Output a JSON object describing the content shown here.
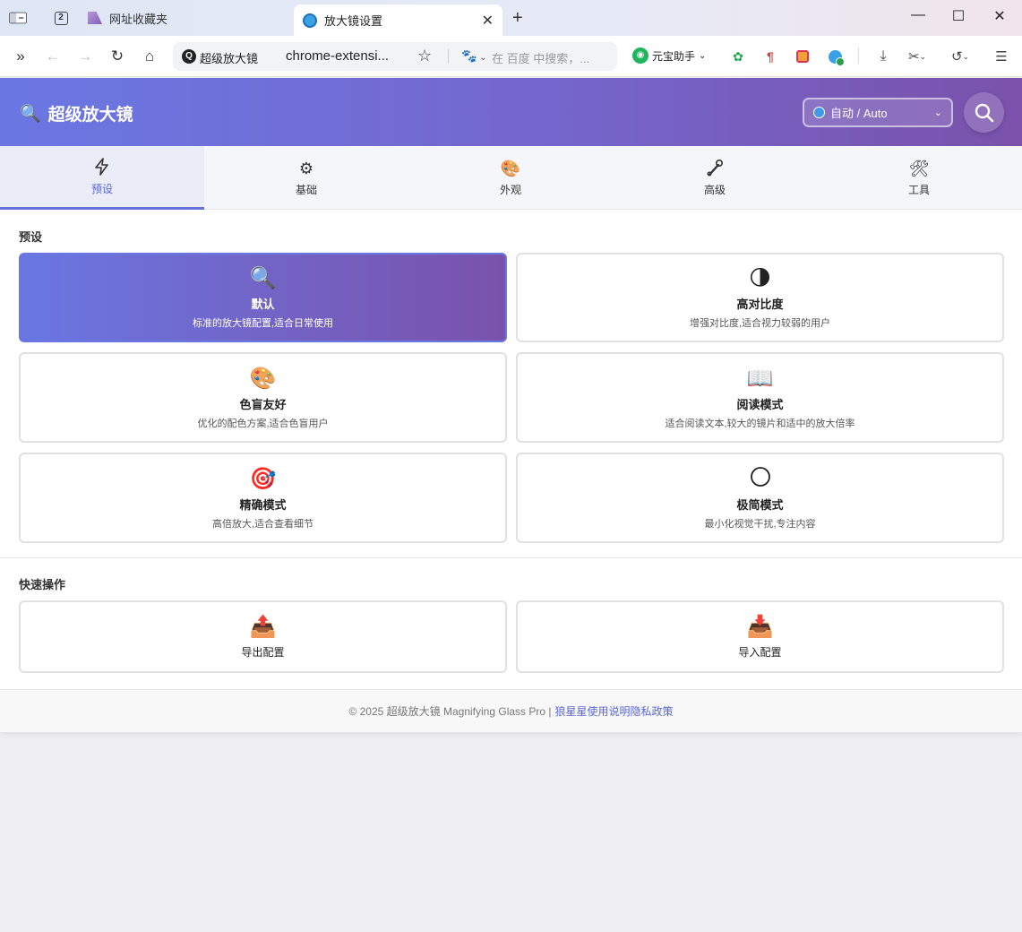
{
  "browser": {
    "tab_count": "2",
    "bookmarks_tab_label": "网址收藏夹",
    "active_tab_title": "放大镜设置",
    "omnibox_site": "超级放大镜",
    "omnibox_url": "chrome-extensi...",
    "search_placeholder": "在 百度 中搜索，...",
    "yuanbao_label": "元宝助手"
  },
  "app": {
    "title": "超级放大镜",
    "language_selected": "自动 / Auto"
  },
  "tabs": [
    {
      "label": "预设",
      "icon": "lightning-icon"
    },
    {
      "label": "基础",
      "icon": "gear-icon"
    },
    {
      "label": "外观",
      "icon": "palette-icon"
    },
    {
      "label": "高级",
      "icon": "wrench-icon"
    },
    {
      "label": "工具",
      "icon": "tools-icon"
    }
  ],
  "presets": {
    "section_title": "预设",
    "items": [
      {
        "name": "默认",
        "desc": "标准的放大镜配置,适合日常使用",
        "icon": "magnifier-icon"
      },
      {
        "name": "高对比度",
        "desc": "增强对比度,适合视力较弱的用户",
        "icon": "half-moon-icon"
      },
      {
        "name": "色盲友好",
        "desc": "优化的配色方案,适合色盲用户",
        "icon": "palette-icon"
      },
      {
        "name": "阅读模式",
        "desc": "适合阅读文本,较大的镜片和适中的放大倍率",
        "icon": "book-icon"
      },
      {
        "name": "精确模式",
        "desc": "高倍放大,适合查看细节",
        "icon": "target-icon"
      },
      {
        "name": "极简模式",
        "desc": "最小化视觉干扰,专注内容",
        "icon": "circle-icon"
      }
    ]
  },
  "quick_actions": {
    "section_title": "快速操作",
    "export_label": "导出配置",
    "import_label": "导入配置"
  },
  "footer": {
    "copyright": "© 2025 超级放大镜 Magnifying Glass Pro |",
    "link_author": "狼星星",
    "link_guide": "使用说明",
    "link_privacy": "隐私政策"
  },
  "colors": {
    "accent": "#6673dc",
    "header_gradient_start": "#6a77e2",
    "header_gradient_end": "#7a52ab"
  }
}
